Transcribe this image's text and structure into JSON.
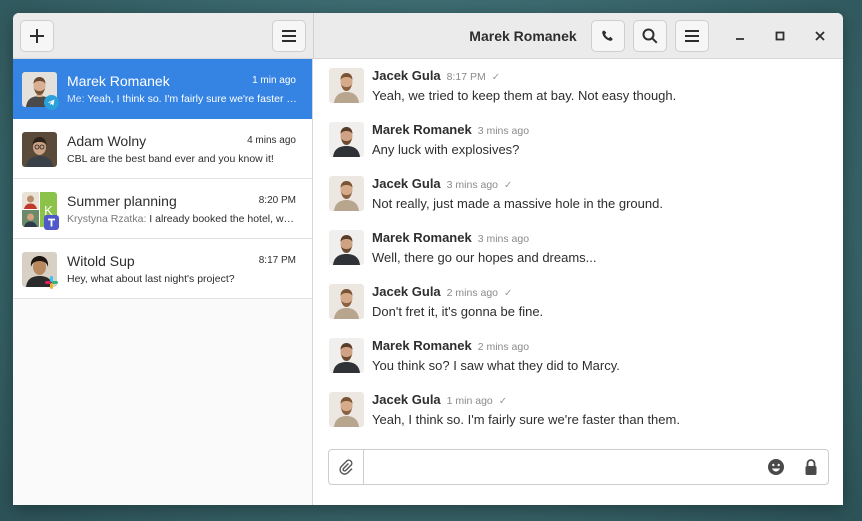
{
  "header": {
    "title": "Marek Romanek",
    "new_chat_icon": "plus-icon",
    "left_menu_icon": "hamburger-menu-icon",
    "call_icon": "phone-icon",
    "search_icon": "search-icon",
    "right_menu_icon": "hamburger-menu-icon",
    "minimize_icon": "minimize-icon",
    "maximize_icon": "maximize-icon",
    "close_icon": "close-icon"
  },
  "sidebar": {
    "chats": [
      {
        "name": "Marek Romanek",
        "time": "1 min ago",
        "sender": "Me:",
        "preview": " Yeah, I think so. I'm fairly sure we're faster than them.",
        "active": true,
        "badge": "telegram-icon"
      },
      {
        "name": "Adam Wolny",
        "time": "4 mins ago",
        "sender": "",
        "preview": "CBL are the best band ever and you know it!",
        "active": false,
        "badge": ""
      },
      {
        "name": "Summer planning",
        "time": "8:20 PM",
        "sender": "Krystyna Rzatka:",
        "preview": " I already booked the hotel, we're good",
        "active": false,
        "badge": "teams-icon"
      },
      {
        "name": "Witold Sup",
        "time": "8:17 PM",
        "sender": "",
        "preview": "Hey, what about last night's project?",
        "active": false,
        "badge": "slack-icon"
      }
    ]
  },
  "messages": [
    {
      "author": "Jacek Gula",
      "time": "8:17 PM",
      "check": "✓",
      "text": "Yeah, we tried to keep them at bay. Not easy though."
    },
    {
      "author": "Marek Romanek",
      "time": "3 mins ago",
      "check": "",
      "text": "Any luck with explosives?"
    },
    {
      "author": "Jacek Gula",
      "time": "3 mins ago",
      "check": "✓",
      "text": "Not really, just made a massive hole in the ground."
    },
    {
      "author": "Marek Romanek",
      "time": "3 mins ago",
      "check": "",
      "text": "Well, there go our hopes and dreams..."
    },
    {
      "author": "Jacek Gula",
      "time": "2 mins ago",
      "check": "✓",
      "text": "Don't fret it, it's gonna be fine."
    },
    {
      "author": "Marek Romanek",
      "time": "2 mins ago",
      "check": "",
      "text": "You think so? I saw what they did to Marcy."
    },
    {
      "author": "Jacek Gula",
      "time": "1 min ago",
      "check": "✓",
      "text": "Yeah, I think so. I'm fairly sure we're faster than them."
    }
  ],
  "composer": {
    "value": "",
    "placeholder": "",
    "attach_icon": "paperclip-icon",
    "emoji_icon": "emoji-icon",
    "lock_icon": "lock-icon"
  },
  "colors": {
    "accent": "#3584e4",
    "telegram": "#2aa1da",
    "teams": "#5059c9"
  }
}
